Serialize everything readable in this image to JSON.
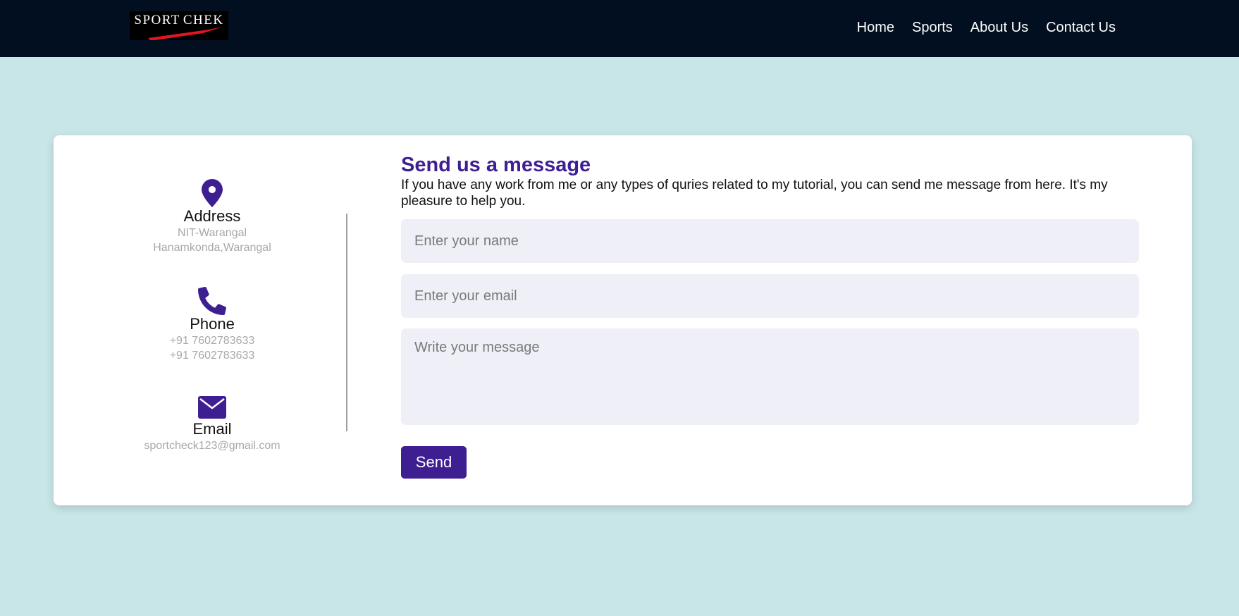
{
  "brand": {
    "logo_text": "SPORTCHEK"
  },
  "nav": {
    "items": [
      {
        "label": "Home"
      },
      {
        "label": "Sports"
      },
      {
        "label": "About Us"
      },
      {
        "label": "Contact Us"
      }
    ]
  },
  "contact_info": {
    "address": {
      "icon": "map-pin-icon",
      "title": "Address",
      "line1": "NIT-Warangal",
      "line2": "Hanamkonda,Warangal"
    },
    "phone": {
      "icon": "phone-icon",
      "title": "Phone",
      "line1": "+91 7602783633",
      "line2": "+91 7602783633"
    },
    "email": {
      "icon": "envelope-icon",
      "title": "Email",
      "line1": "sportcheck123@gmail.com"
    }
  },
  "form": {
    "title": "Send us a message",
    "description": "If you have any work from me or any types of quries related to my tutorial, you can send me message from here. It's my pleasure to help you.",
    "name_placeholder": "Enter your name",
    "email_placeholder": "Enter your email",
    "message_placeholder": "Write your message",
    "name_value": "",
    "email_value": "",
    "message_value": "",
    "send_label": "Send"
  },
  "colors": {
    "accent": "#3e1f92",
    "navbar": "#020f20",
    "page_background": "#c8e6e8",
    "field_background": "#efeff8"
  }
}
